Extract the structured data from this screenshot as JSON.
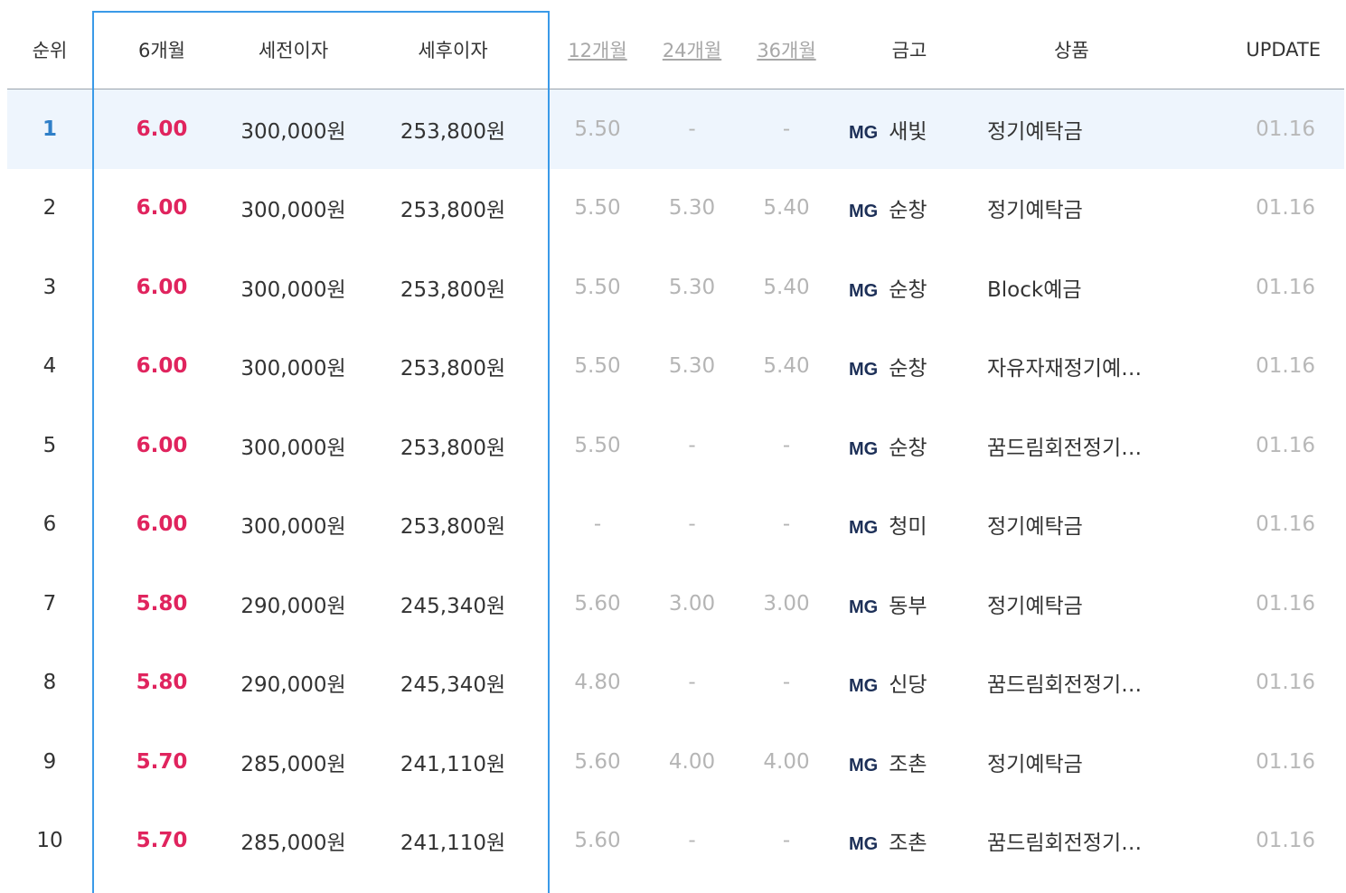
{
  "headers": {
    "rank": "순위",
    "six_month": "6개월",
    "pre_tax": "세전이자",
    "post_tax": "세후이자",
    "twelve_month": "12개월",
    "twentyfour_month": "24개월",
    "thirtysix_month": "36개월",
    "bank": "금고",
    "product": "상품",
    "update": "UPDATE"
  },
  "rows": [
    {
      "rank": "1",
      "six": "6.00",
      "pre": "300,000원",
      "post": "253,800원",
      "t12": "5.50",
      "t24": "-",
      "t36": "-",
      "brand": "MG",
      "branch": "새빛",
      "product": "정기예탁금",
      "update": "01.16"
    },
    {
      "rank": "2",
      "six": "6.00",
      "pre": "300,000원",
      "post": "253,800원",
      "t12": "5.50",
      "t24": "5.30",
      "t36": "5.40",
      "brand": "MG",
      "branch": "순창",
      "product": "정기예탁금",
      "update": "01.16"
    },
    {
      "rank": "3",
      "six": "6.00",
      "pre": "300,000원",
      "post": "253,800원",
      "t12": "5.50",
      "t24": "5.30",
      "t36": "5.40",
      "brand": "MG",
      "branch": "순창",
      "product": "Block예금",
      "update": "01.16"
    },
    {
      "rank": "4",
      "six": "6.00",
      "pre": "300,000원",
      "post": "253,800원",
      "t12": "5.50",
      "t24": "5.30",
      "t36": "5.40",
      "brand": "MG",
      "branch": "순창",
      "product": "자유자재정기예…",
      "update": "01.16"
    },
    {
      "rank": "5",
      "six": "6.00",
      "pre": "300,000원",
      "post": "253,800원",
      "t12": "5.50",
      "t24": "-",
      "t36": "-",
      "brand": "MG",
      "branch": "순창",
      "product": "꿈드림회전정기…",
      "update": "01.16"
    },
    {
      "rank": "6",
      "six": "6.00",
      "pre": "300,000원",
      "post": "253,800원",
      "t12": "-",
      "t24": "-",
      "t36": "-",
      "brand": "MG",
      "branch": "청미",
      "product": "정기예탁금",
      "update": "01.16"
    },
    {
      "rank": "7",
      "six": "5.80",
      "pre": "290,000원",
      "post": "245,340원",
      "t12": "5.60",
      "t24": "3.00",
      "t36": "3.00",
      "brand": "MG",
      "branch": "동부",
      "product": "정기예탁금",
      "update": "01.16"
    },
    {
      "rank": "8",
      "six": "5.80",
      "pre": "290,000원",
      "post": "245,340원",
      "t12": "4.80",
      "t24": "-",
      "t36": "-",
      "brand": "MG",
      "branch": "신당",
      "product": "꿈드림회전정기…",
      "update": "01.16"
    },
    {
      "rank": "9",
      "six": "5.70",
      "pre": "285,000원",
      "post": "241,110원",
      "t12": "5.60",
      "t24": "4.00",
      "t36": "4.00",
      "brand": "MG",
      "branch": "조촌",
      "product": "정기예탁금",
      "update": "01.16"
    },
    {
      "rank": "10",
      "six": "5.70",
      "pre": "285,000원",
      "post": "241,110원",
      "t12": "5.60",
      "t24": "-",
      "t36": "-",
      "brand": "MG",
      "branch": "조촌",
      "product": "꿈드림회전정기…",
      "update": "01.16"
    }
  ],
  "colors": {
    "accent_rate": "#e0245e",
    "frame_border": "#3a9ae8",
    "highlight_row": "#eef5fd",
    "brand": "#1c2f57"
  }
}
